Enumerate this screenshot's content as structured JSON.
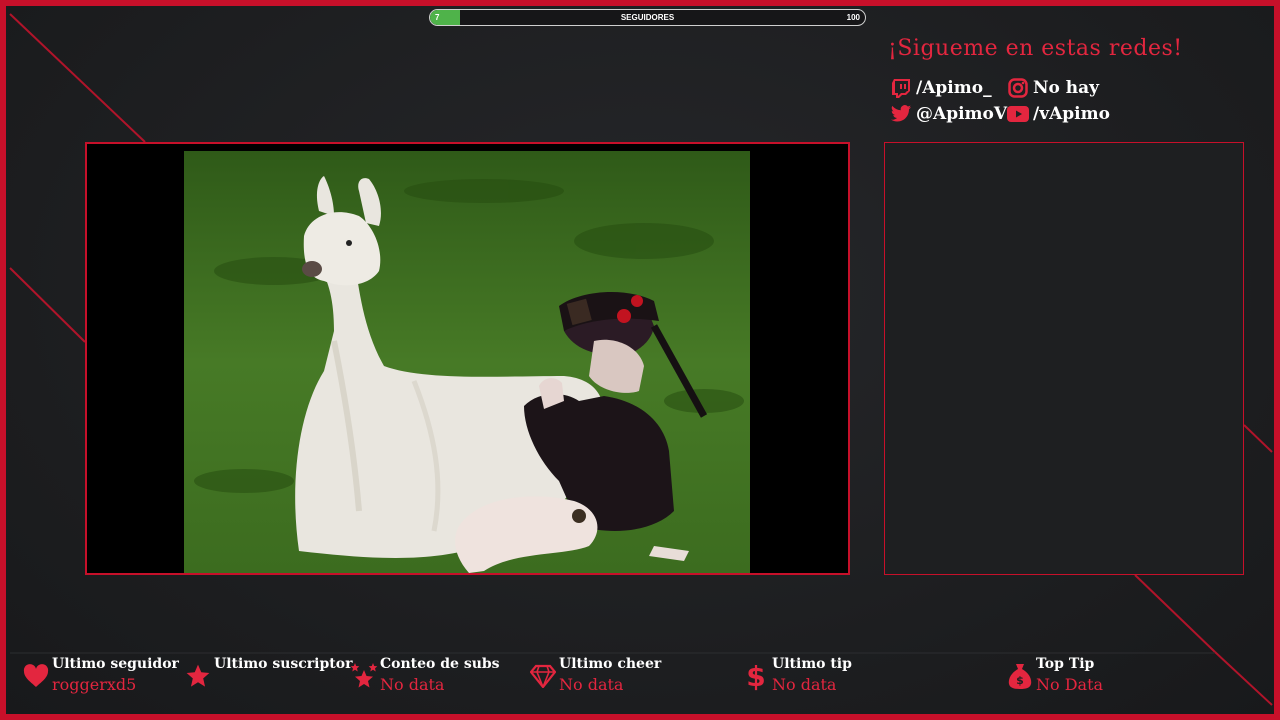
{
  "colors": {
    "accent": "#c7102a",
    "accent_text": "#e3263f",
    "goal_fill": "#4fb34a",
    "background": "#1f2022"
  },
  "goal": {
    "label": "SEGUIDORES",
    "current": "7",
    "target": "100",
    "progress": 0.07
  },
  "social": {
    "title": "¡Sigueme en estas redes!",
    "items": [
      {
        "icon": "twitch-icon",
        "text": "/Apimo_"
      },
      {
        "icon": "instagram-icon",
        "text": "No hay"
      },
      {
        "icon": "twitter-icon",
        "text": "@ApimoV"
      },
      {
        "icon": "youtube-icon",
        "text": "/vApimo"
      }
    ]
  },
  "stats": [
    {
      "icon": "heart-icon",
      "label": "Ultimo seguidor",
      "value": "roggerxd5"
    },
    {
      "icon": "star-icon",
      "label": "Ultimo suscriptor",
      "value": ""
    },
    {
      "icon": "stars-icon",
      "label": "Conteo de subs",
      "value": "No data"
    },
    {
      "icon": "diamond-icon",
      "label": "Ultimo cheer",
      "value": "No data"
    },
    {
      "icon": "dollar-icon",
      "label": "Ultimo tip",
      "value": "No data"
    },
    {
      "icon": "money-bag-icon",
      "label": "Top Tip",
      "value": "No Data"
    }
  ]
}
